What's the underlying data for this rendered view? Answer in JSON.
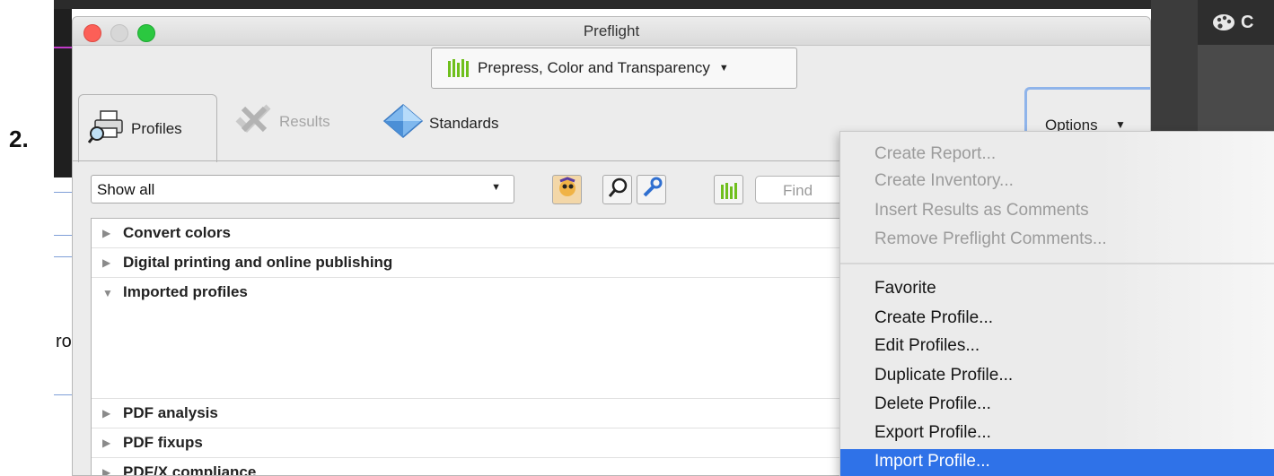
{
  "step_label": "2.",
  "background_left_text": "rof",
  "background_right_header": "C",
  "window": {
    "title": "Preflight",
    "profile_selector": "Prepress, Color and Transparency"
  },
  "tabs": [
    {
      "label": "Profiles",
      "state": "active"
    },
    {
      "label": "Results",
      "state": "disabled"
    },
    {
      "label": "Standards",
      "state": "normal"
    }
  ],
  "options_label": "Options",
  "filter_select": "Show all",
  "find_placeholder": "Find",
  "tree_items": [
    {
      "label": "Convert colors",
      "expanded": false
    },
    {
      "label": "Digital printing and online publishing",
      "expanded": false
    },
    {
      "label": "Imported profiles",
      "expanded": true
    },
    {
      "label": "PDF analysis",
      "expanded": false
    },
    {
      "label": "PDF fixups",
      "expanded": false
    },
    {
      "label": "PDF/X compliance",
      "expanded": false
    }
  ],
  "options_menu": {
    "group1": [
      {
        "label": "Create Report...",
        "enabled": false
      },
      {
        "label": "Create Inventory...",
        "enabled": false
      },
      {
        "label": "Insert Results as Comments",
        "enabled": false
      },
      {
        "label": "Remove Preflight Comments...",
        "enabled": false
      }
    ],
    "group2": [
      {
        "label": "Favorite",
        "enabled": true
      },
      {
        "label": "Create Profile...",
        "enabled": true
      },
      {
        "label": "Edit Profiles...",
        "enabled": true
      },
      {
        "label": "Duplicate Profile...",
        "enabled": true
      },
      {
        "label": "Delete Profile...",
        "enabled": true
      },
      {
        "label": "Export Profile...",
        "enabled": true
      },
      {
        "label": "Import Profile...",
        "enabled": true,
        "highlighted": true
      }
    ]
  },
  "colors": {
    "accent_highlight": "#2f72e8",
    "bars_green": "#6fbf1d",
    "close_red": "#fc5f57",
    "zoom_green": "#2bc840"
  },
  "icons": [
    "printer-magnifier-icon",
    "results-icon",
    "diamond-icon",
    "bars-icon",
    "wizard-icon",
    "magnifier-icon",
    "wrench-icon",
    "palette-icon"
  ]
}
